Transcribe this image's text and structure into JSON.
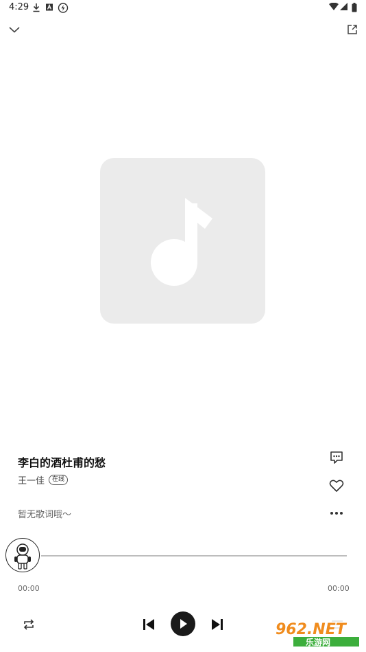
{
  "status_bar": {
    "time": "4:29"
  },
  "song": {
    "title": "李白的酒杜甫的愁",
    "artist": "王一佳",
    "source_tag": "在线",
    "lyrics_placeholder": "暂无歌词哦～"
  },
  "progress": {
    "current_time": "00:00",
    "total_time": "00:00",
    "fraction": 0
  },
  "watermark": {
    "text_top": "962.NET",
    "text_bottom": "乐游网"
  },
  "colors": {
    "art_background": "#ebebeb",
    "art_glyph": "#ffffff",
    "play_button": "#1a1a1a",
    "watermark_orange": "#f08c1e",
    "watermark_green": "#3cae3c"
  },
  "icons": {
    "collapse": "chevron-down-icon",
    "share": "share-icon",
    "comment": "comment-icon",
    "like": "heart-icon",
    "more": "more-icon",
    "repeat": "repeat-icon",
    "previous": "previous-icon",
    "play": "play-icon",
    "next": "next-icon",
    "playlist": "playlist-icon"
  }
}
